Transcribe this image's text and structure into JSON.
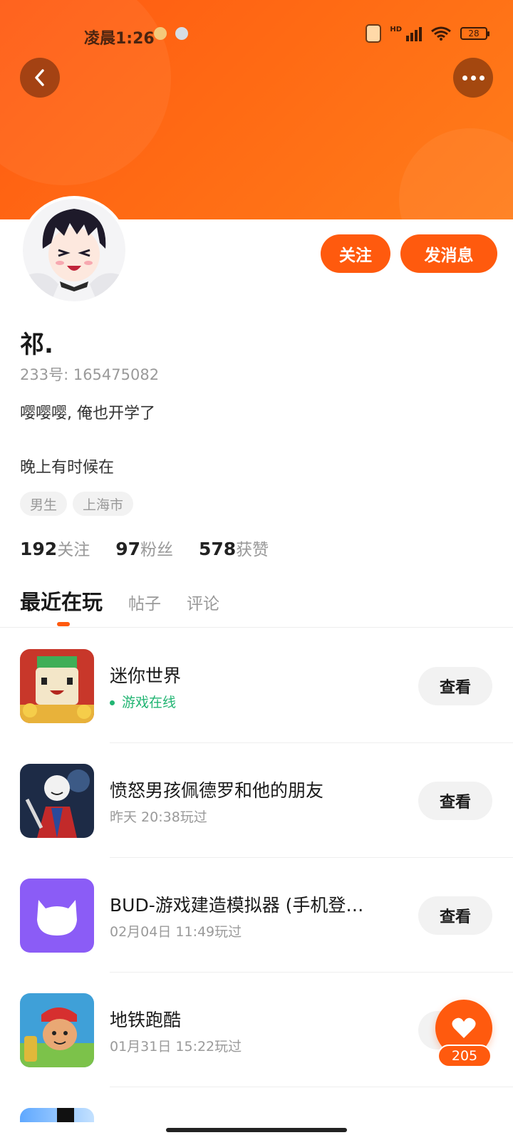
{
  "status_bar": {
    "time": "凌晨1:26",
    "hd": "HD",
    "battery": "28"
  },
  "header": {
    "back_icon": "chevron-left-icon",
    "more_icon": "more-dots-icon"
  },
  "profile": {
    "follow_label": "关注",
    "message_label": "发消息",
    "username": "祁.",
    "uid": "233号: 165475082",
    "bio_line1": "嘤嘤嘤, 俺也开学了",
    "bio_line2": "晚上有时候在",
    "tags": [
      "男生",
      "上海市"
    ],
    "stats": [
      {
        "value": "192",
        "label": "关注"
      },
      {
        "value": "97",
        "label": "粉丝"
      },
      {
        "value": "578",
        "label": "获赞"
      }
    ]
  },
  "tabs": [
    {
      "label": "最近在玩",
      "active": true
    },
    {
      "label": "帖子",
      "active": false
    },
    {
      "label": "评论",
      "active": false
    }
  ],
  "games": [
    {
      "title": "迷你世界",
      "subtitle": "游戏在线",
      "online": true,
      "button": "查看"
    },
    {
      "title": "愤怒男孩佩德罗和他的朋友",
      "subtitle": "昨天 20:38玩过",
      "online": false,
      "button": "查看"
    },
    {
      "title": "BUD-游戏建造模拟器 (手机登…",
      "subtitle": "02月04日 11:49玩过",
      "online": false,
      "button": "查看"
    },
    {
      "title": "地铁跑酷",
      "subtitle": "01月31日 15:22玩过",
      "online": false,
      "button": "查看"
    }
  ],
  "like": {
    "count": "205",
    "icon": "heart-icon"
  },
  "colors": {
    "accent": "#ff5a0e",
    "online": "#22b573"
  }
}
